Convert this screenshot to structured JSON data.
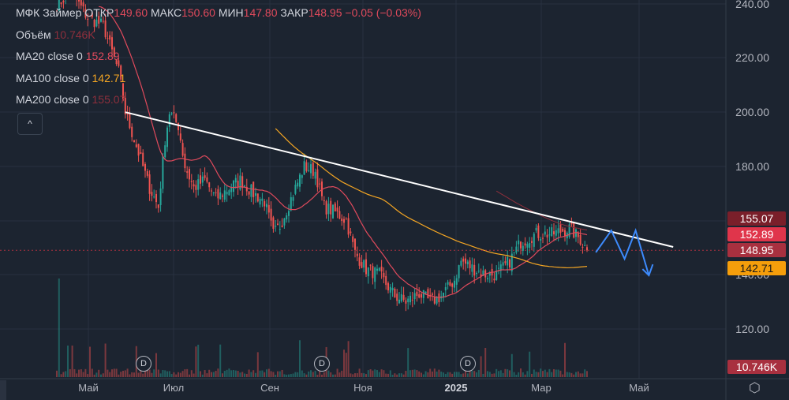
{
  "header": {
    "symbol": "МФК Займер",
    "open_label": "ОТКР",
    "open": "149.60",
    "high_label": "МАКС",
    "high": "150.60",
    "low_label": "МИН",
    "low": "147.80",
    "close_label": "ЗАКР",
    "close": "148.95",
    "change": "−0.05 (−0.03%)"
  },
  "legend": {
    "volume_label": "Объём",
    "volume": "10.746K",
    "ma20_label": "MA20 close 0",
    "ma20": "152.89",
    "ma100_label": "MA100 close 0",
    "ma100": "142.71",
    "ma200_label": "MA200 close 0",
    "ma200": "155.07",
    "collapse_icon": "^"
  },
  "price_axis": {
    "ticks": [
      "240.00",
      "220.00",
      "200.00",
      "180.00",
      "140.00",
      "120.00"
    ],
    "badges": {
      "ma200": "155.07",
      "ma20": "152.89",
      "last": "148.95",
      "ma100": "142.71",
      "volume": "10.746K"
    }
  },
  "time_axis": {
    "labels": [
      "Май",
      "Июл",
      "Сен",
      "Ноя",
      "2025",
      "Мар",
      "Май"
    ]
  },
  "dividend_marker": "D",
  "colors": {
    "bg": "#1c2430",
    "up": "#26a69a",
    "down": "#ef5350",
    "ma20": "#e04a5c",
    "ma100": "#f5a623",
    "ma200": "#8e2f3c",
    "trend": "#ffffff",
    "forecast": "#3d8bfd"
  },
  "chart_data": {
    "type": "candlestick",
    "title": "МФК Займер",
    "ylim": [
      115,
      245
    ],
    "close_keypoints_by_bar": [
      [
        1,
        240
      ],
      [
        6,
        245
      ],
      [
        14,
        235
      ],
      [
        21,
        232
      ],
      [
        28,
        215
      ],
      [
        31,
        200
      ],
      [
        37,
        185
      ],
      [
        42,
        172
      ],
      [
        46,
        165
      ],
      [
        49,
        190
      ],
      [
        51,
        200
      ],
      [
        55,
        195
      ],
      [
        58,
        180
      ],
      [
        62,
        172
      ],
      [
        67,
        175
      ],
      [
        72,
        168
      ],
      [
        78,
        172
      ],
      [
        83,
        175
      ],
      [
        89,
        170
      ],
      [
        94,
        167
      ],
      [
        98,
        155
      ],
      [
        101,
        158
      ],
      [
        106,
        168
      ],
      [
        112,
        180
      ],
      [
        117,
        178
      ],
      [
        121,
        165
      ],
      [
        126,
        163
      ],
      [
        131,
        160
      ],
      [
        135,
        148
      ],
      [
        140,
        142
      ],
      [
        146,
        140
      ],
      [
        153,
        132
      ],
      [
        158,
        130
      ],
      [
        164,
        133
      ],
      [
        169,
        130
      ],
      [
        174,
        132
      ],
      [
        180,
        138
      ],
      [
        183,
        145
      ],
      [
        189,
        142
      ],
      [
        194,
        140
      ],
      [
        199,
        140
      ],
      [
        205,
        145
      ],
      [
        210,
        152
      ],
      [
        217,
        155
      ],
      [
        224,
        155
      ],
      [
        232,
        157
      ],
      [
        237,
        153
      ],
      [
        240,
        148.95
      ]
    ],
    "last_close": 148.95,
    "ma20_last": 152.89,
    "ma100_last": 142.71,
    "ma200_last": 155.07,
    "trendline": [
      [
        31,
        200.0
      ],
      [
        279,
        150.2
      ]
    ],
    "forecast_path": [
      [
        244,
        148.2
      ],
      [
        251,
        156.3
      ],
      [
        257,
        145.8
      ],
      [
        262,
        156.3
      ],
      [
        268,
        139.7
      ]
    ],
    "last_volume": "10.746K"
  }
}
